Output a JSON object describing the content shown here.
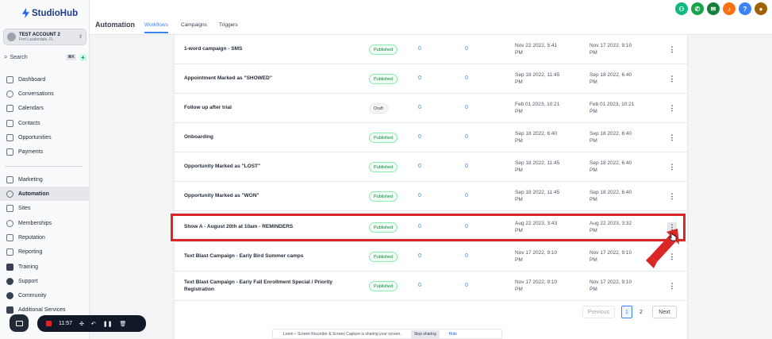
{
  "brand": {
    "name": "StudioHub"
  },
  "account": {
    "name": "TEST ACCOUNT 2",
    "location": "Fort Lauderdale, FL"
  },
  "search": {
    "label": "Search",
    "shortcut": "⌘K"
  },
  "nav_top": [
    {
      "label": "Dashboard"
    },
    {
      "label": "Conversations"
    },
    {
      "label": "Calendars"
    },
    {
      "label": "Contacts"
    },
    {
      "label": "Opportunities"
    },
    {
      "label": "Payments"
    }
  ],
  "nav_bottom": [
    {
      "label": "Marketing"
    },
    {
      "label": "Automation"
    },
    {
      "label": "Sites"
    },
    {
      "label": "Memberships"
    },
    {
      "label": "Reputation"
    },
    {
      "label": "Reporting"
    },
    {
      "label": "Training"
    },
    {
      "label": "Support"
    },
    {
      "label": "Community"
    },
    {
      "label": "Additional Services"
    }
  ],
  "header": {
    "title": "Automation",
    "tabs": [
      {
        "label": "Workflows",
        "active": true
      },
      {
        "label": "Campaigns"
      },
      {
        "label": "Triggers"
      }
    ]
  },
  "workflows": [
    {
      "name": "1-word campaign - SMS",
      "status": "Published",
      "total": "0",
      "active": "0",
      "created": [
        "Nov 22 2022, 5:41",
        "PM"
      ],
      "updated": [
        "Nov 17 2022, 9:10",
        "PM"
      ]
    },
    {
      "name": "Appointment Marked as \"SHOWED\"",
      "status": "Published",
      "total": "0",
      "active": "0",
      "created": [
        "Sep 18 2022, 11:45",
        "PM"
      ],
      "updated": [
        "Sep 18 2022, 6:40",
        "PM"
      ]
    },
    {
      "name": "Follow up after trial",
      "status": "Draft",
      "total": "0",
      "active": "0",
      "created": [
        "Feb 01 2023, 10:21",
        "PM"
      ],
      "updated": [
        "Feb 01 2023, 10:21",
        "PM"
      ]
    },
    {
      "name": "Onboarding",
      "status": "Published",
      "total": "0",
      "active": "0",
      "created": [
        "Sep 18 2022, 6:40",
        "PM"
      ],
      "updated": [
        "Sep 18 2022, 6:40",
        "PM"
      ]
    },
    {
      "name": "Opportunity Marked as \"LOST\"",
      "status": "Published",
      "total": "0",
      "active": "0",
      "created": [
        "Sep 18 2022, 11:45",
        "PM"
      ],
      "updated": [
        "Sep 18 2022, 6:40",
        "PM"
      ]
    },
    {
      "name": "Opportunity Marked as \"WON\"",
      "status": "Published",
      "total": "0",
      "active": "0",
      "created": [
        "Sep 18 2022, 11:45",
        "PM"
      ],
      "updated": [
        "Sep 18 2022, 6:40",
        "PM"
      ]
    },
    {
      "name": "Show A - August 20th at 10am - REMINDERS",
      "status": "Published",
      "total": "0",
      "active": "0",
      "created": [
        "Aug 22 2023, 3:43",
        "PM"
      ],
      "updated": [
        "Aug 22 2023, 3:32",
        "PM"
      ]
    },
    {
      "name": "Text Blast Campaign - Early Bird Summer camps",
      "status": "Published",
      "total": "0",
      "active": "0",
      "created": [
        "Nov 17 2022, 9:10",
        "PM"
      ],
      "updated": [
        "Nov 17 2022, 9:10",
        "PM"
      ]
    },
    {
      "name": "Text Blast Campaign - Early Fall Enrollment Special / Priority Registration",
      "status": "Published",
      "total": "0",
      "active": "0",
      "created": [
        "Nov 17 2022, 9:10",
        "PM"
      ],
      "updated": [
        "Nov 17 2022, 9:10",
        "PM"
      ]
    }
  ],
  "pagination": {
    "previous": "Previous",
    "pages": [
      "1",
      "2"
    ],
    "next": "Next"
  },
  "recorder": {
    "time": "11:57"
  },
  "loom": {
    "message": "Loom – Screen Recorder & Screen Capture is sharing your screen.",
    "stop": "Stop sharing",
    "hide": "Hide"
  },
  "colors": {
    "accent": "#3b82f6",
    "highlight": "#dc2626",
    "published": "#15803d"
  }
}
